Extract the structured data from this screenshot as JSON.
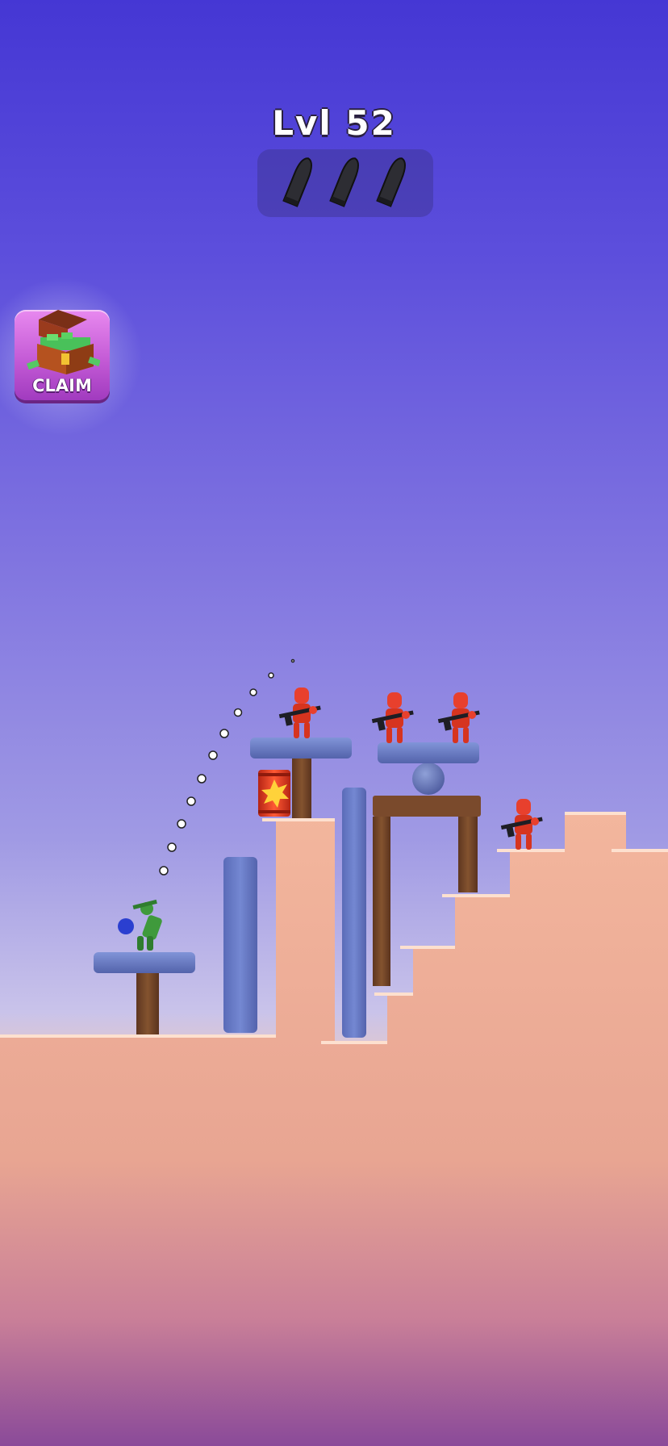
{
  "hud": {
    "level_label": "Lvl 52",
    "ammo_remaining": 3,
    "ammo_icon": "bullet-icon"
  },
  "claim_button": {
    "label": "CLAIM",
    "icon": "treasure-chest-icon"
  },
  "colors": {
    "enemy": "#e8402d",
    "player": "#3f9a3c",
    "ground": "#f0b39a",
    "stone_block": "#6c7fc9",
    "wood": "#7a4a2c",
    "barrel": "#e53a1f"
  },
  "enemies_count": 4
}
